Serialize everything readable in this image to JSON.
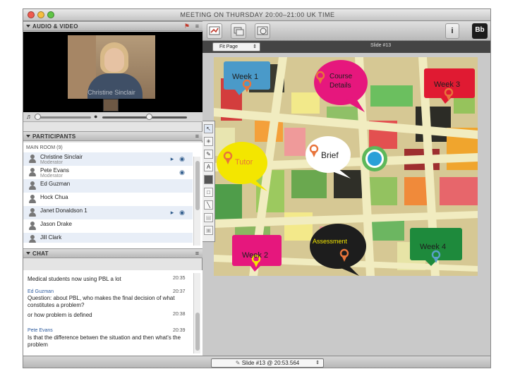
{
  "window": {
    "title": "MEETING ON THURSDAY 20:00–21:00 UK TIME"
  },
  "audio_video": {
    "header": "AUDIO & VIDEO",
    "camera_caption": "Christine Sinclair",
    "speaker_volume_level": 0.05,
    "mic_volume_level": 0.55
  },
  "participants": {
    "header": "PARTICIPANTS",
    "room": "MAIN ROOM (9)",
    "list": [
      {
        "name": "Christine Sinclair",
        "role": "Moderator"
      },
      {
        "name": "Pete Evans",
        "role": "Moderator"
      },
      {
        "name": "Ed Guzman",
        "role": ""
      },
      {
        "name": "Hock Chua",
        "role": ""
      },
      {
        "name": "Janet Donaldson 1",
        "role": ""
      },
      {
        "name": "Jason Drake",
        "role": ""
      },
      {
        "name": "Jill Clark",
        "role": ""
      }
    ]
  },
  "chat": {
    "header": "CHAT",
    "messages": [
      {
        "author": "",
        "text": "Medical students now using PBL a lot",
        "time": "20:35"
      },
      {
        "author": "Ed Guzman",
        "text": "Question: about PBL, who makes the final decision of what constitutes a problem?",
        "time": "20:37"
      },
      {
        "author": "",
        "text": "or how problem is defined",
        "time": "20:38"
      },
      {
        "author": "Pete Evans",
        "text": "Is that the difference betwen the situation and then what's the problem",
        "time": "20:39"
      }
    ]
  },
  "whiteboard": {
    "zoom_select": "Fit Page",
    "slide_label": "Slide #13",
    "bottom_slide_select": "Slide #13 @ 20:53.564",
    "bubbles": [
      {
        "label": "Week 1"
      },
      {
        "label": "Course Details"
      },
      {
        "label": "Week 3"
      },
      {
        "label": "Tutor"
      },
      {
        "label": "Brief"
      },
      {
        "label": "Assessment"
      },
      {
        "label": "Week 2"
      },
      {
        "label": "Week 4"
      }
    ]
  },
  "toolbar": {
    "info_label": "i",
    "logo_text": "Bb"
  },
  "colors": {
    "week1": "#4a9ac9",
    "course_details": "#e6177d",
    "week3": "#e01a32",
    "tutor": "#f3e600",
    "brief": "#ffffff",
    "assessment": "#1d1d1d",
    "week2": "#e6177d",
    "week4": "#1e8a3c",
    "pin": "#e8743b"
  },
  "icons": {
    "collapse": "triangle-down-icon",
    "panel_menu": "panel-menu-icon",
    "user": "user-icon",
    "video_cam": "video-camera-icon",
    "mic": "microphone-icon",
    "pointer": "pointer-tool-icon",
    "location_pin": "location-pin-icon"
  }
}
